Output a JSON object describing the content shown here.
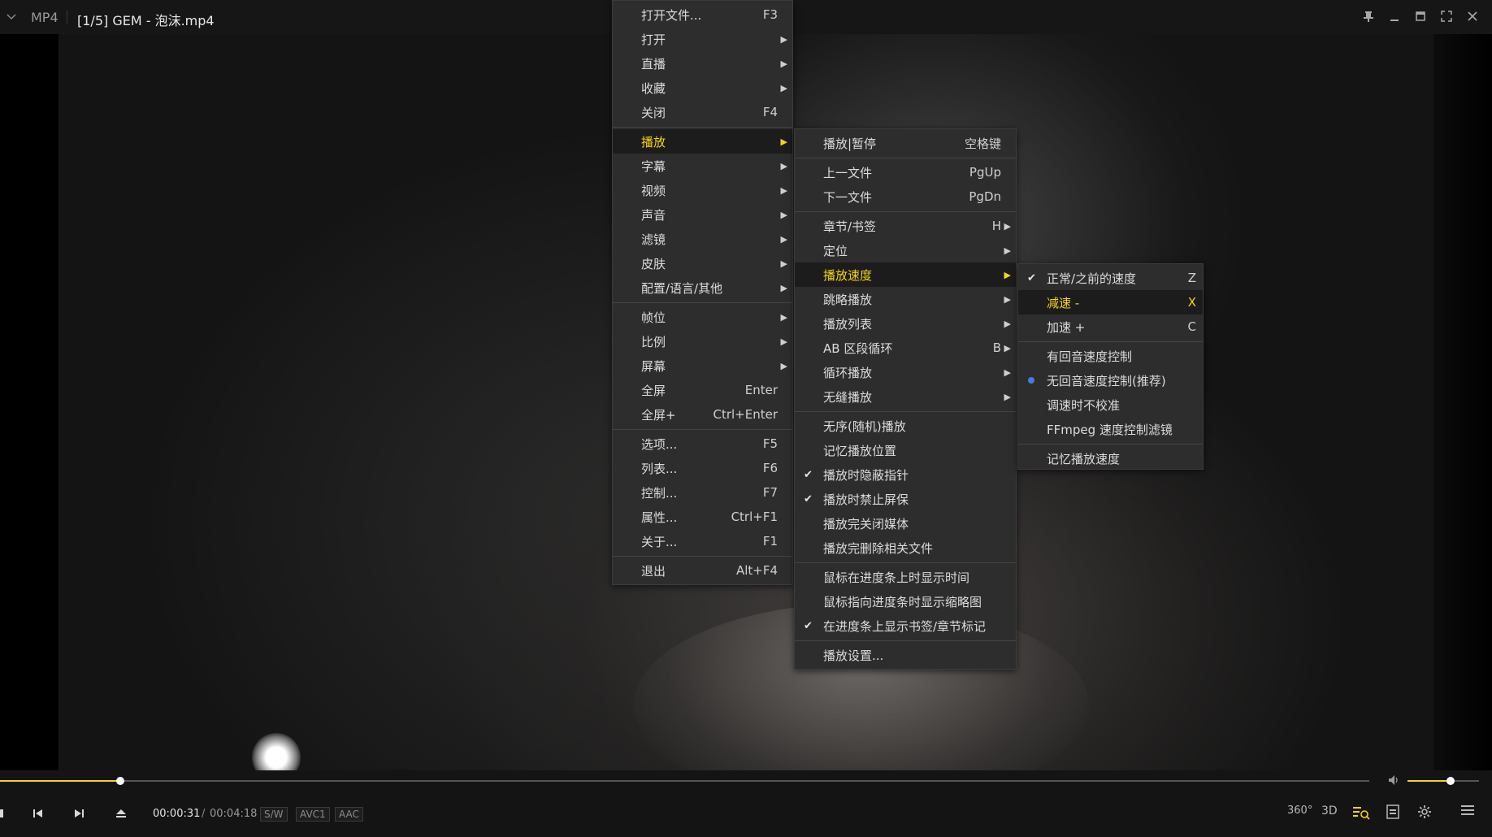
{
  "titlebar": {
    "format": "MP4",
    "title": "[1/5] GEM - 泡沫.mp4"
  },
  "main_menu": [
    {
      "label": "打开文件...",
      "shortcut": "F3",
      "arrow": false
    },
    {
      "label": "打开",
      "shortcut": "",
      "arrow": true
    },
    {
      "label": "直播",
      "shortcut": "",
      "arrow": true
    },
    {
      "label": "收藏",
      "shortcut": "",
      "arrow": true
    },
    {
      "label": "关闭",
      "shortcut": "F4",
      "arrow": false
    },
    {
      "label": "播放",
      "shortcut": "",
      "arrow": true,
      "active": true
    },
    {
      "label": "字幕",
      "shortcut": "",
      "arrow": true
    },
    {
      "label": "视频",
      "shortcut": "",
      "arrow": true
    },
    {
      "label": "声音",
      "shortcut": "",
      "arrow": true
    },
    {
      "label": "滤镜",
      "shortcut": "",
      "arrow": true
    },
    {
      "label": "皮肤",
      "shortcut": "",
      "arrow": true
    },
    {
      "label": "配置/语言/其他",
      "shortcut": "",
      "arrow": true
    },
    {
      "label": "帧位",
      "shortcut": "",
      "arrow": true
    },
    {
      "label": "比例",
      "shortcut": "",
      "arrow": true
    },
    {
      "label": "屏幕",
      "shortcut": "",
      "arrow": true
    },
    {
      "label": "全屏",
      "shortcut": "Enter",
      "arrow": false
    },
    {
      "label": "全屏+",
      "shortcut": "Ctrl+Enter",
      "arrow": false
    },
    {
      "label": "选项...",
      "shortcut": "F5",
      "arrow": false
    },
    {
      "label": "列表...",
      "shortcut": "F6",
      "arrow": false
    },
    {
      "label": "控制...",
      "shortcut": "F7",
      "arrow": false
    },
    {
      "label": "属性...",
      "shortcut": "Ctrl+F1",
      "arrow": false
    },
    {
      "label": "关于...",
      "shortcut": "F1",
      "arrow": false
    },
    {
      "label": "退出",
      "shortcut": "Alt+F4",
      "arrow": false
    }
  ],
  "play_menu": [
    {
      "label": "播放|暂停",
      "shortcut": "空格键"
    },
    {
      "label": "上一文件",
      "shortcut": "PgUp"
    },
    {
      "label": "下一文件",
      "shortcut": "PgDn"
    },
    {
      "label": "章节/书签",
      "shortcut": "H",
      "arrow": true
    },
    {
      "label": "定位",
      "arrow": true
    },
    {
      "label": "播放速度",
      "arrow": true,
      "active": true
    },
    {
      "label": "跳略播放",
      "arrow": true
    },
    {
      "label": "播放列表",
      "arrow": true
    },
    {
      "label": "AB 区段循环",
      "shortcut": "B",
      "arrow": true
    },
    {
      "label": "循环播放",
      "arrow": true
    },
    {
      "label": "无缝播放",
      "arrow": true
    },
    {
      "label": "无序(随机)播放"
    },
    {
      "label": "记忆播放位置"
    },
    {
      "label": "播放时隐蔽指针",
      "checked": true
    },
    {
      "label": "播放时禁止屏保",
      "checked": true
    },
    {
      "label": "播放完关闭媒体"
    },
    {
      "label": "播放完删除相关文件"
    },
    {
      "label": "鼠标在进度条上时显示时间"
    },
    {
      "label": "鼠标指向进度条时显示缩略图"
    },
    {
      "label": "在进度条上显示书签/章节标记",
      "checked": true
    },
    {
      "label": "播放设置..."
    }
  ],
  "speed_menu": [
    {
      "label": "正常/之前的速度",
      "shortcut": "Z",
      "checked": true
    },
    {
      "label": "减速 -",
      "shortcut": "X",
      "active": true
    },
    {
      "label": "加速 +",
      "shortcut": "C"
    },
    {
      "label": "有回音速度控制"
    },
    {
      "label": "无回音速度控制(推荐)",
      "radio": true
    },
    {
      "label": "调速时不校准"
    },
    {
      "label": "FFmpeg 速度控制滤镜"
    },
    {
      "label": "记忆播放速度"
    }
  ],
  "player": {
    "time_current": "00:00:31",
    "time_separator": "/",
    "time_total": "00:04:18",
    "badges": [
      "S/W",
      "AVC1",
      "AAC"
    ],
    "seek_progress": 0.088,
    "volume_level": 0.6,
    "right_icons": [
      "360-icon",
      "3d-icon",
      "playlist-search-icon",
      "subtitle-icon",
      "settings-icon",
      "menu-icon"
    ],
    "label_360": "360°",
    "label_3d": "3D"
  },
  "colors": {
    "accent": "#f5d412",
    "radio": "#3d7de8",
    "menu_bg": "#2d2d2d"
  }
}
